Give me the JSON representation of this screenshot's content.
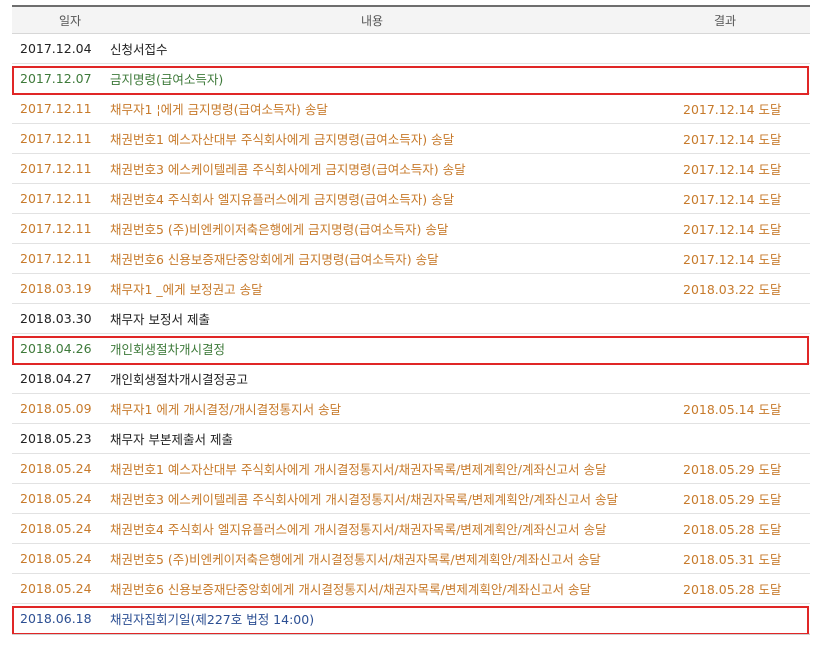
{
  "header": {
    "date": "일자",
    "content": "내용",
    "result": "결과"
  },
  "rows": [
    {
      "date": "2017.12.04",
      "content": "신청서접수",
      "result": "",
      "color": "black"
    },
    {
      "date": "2017.12.07",
      "content": "금지명령(급여소득자)",
      "result": "",
      "color": "green",
      "highlighted": true
    },
    {
      "date": "2017.12.11",
      "content": "채무자1        ¦에게 금지명령(급여소득자) 송달",
      "result": "2017.12.14 도달",
      "color": "orange"
    },
    {
      "date": "2017.12.11",
      "content": "채권번호1 예스자산대부 주식회사에게 금지명령(급여소득자) 송달",
      "result": "2017.12.14 도달",
      "color": "orange"
    },
    {
      "date": "2017.12.11",
      "content": "채권번호3 에스케이텔레콤 주식회사에게 금지명령(급여소득자) 송달",
      "result": "2017.12.14 도달",
      "color": "orange"
    },
    {
      "date": "2017.12.11",
      "content": "채권번호4 주식회사 엘지유플러스에게 금지명령(급여소득자) 송달",
      "result": "2017.12.14 도달",
      "color": "orange"
    },
    {
      "date": "2017.12.11",
      "content": "채권번호5 (주)비엔케이저축은행에게 금지명령(급여소득자) 송달",
      "result": "2017.12.14 도달",
      "color": "orange"
    },
    {
      "date": "2017.12.11",
      "content": "채권번호6 신용보증재단중앙회에게 금지명령(급여소득자) 송달",
      "result": "2017.12.14 도달",
      "color": "orange"
    },
    {
      "date": "2018.03.19",
      "content": "채무자1    _에게 보정권고 송달",
      "result": "2018.03.22 도달",
      "color": "orange"
    },
    {
      "date": "2018.03.30",
      "content": "채무자       보정서 제출",
      "result": "",
      "color": "black"
    },
    {
      "date": "2018.04.26",
      "content": "개인회생절차개시결정",
      "result": "",
      "color": "green",
      "highlighted": true
    },
    {
      "date": "2018.04.27",
      "content": "개인회생절차개시결정공고",
      "result": "",
      "color": "black"
    },
    {
      "date": "2018.05.09",
      "content": "채무자1          에게 개시결정/개시결정통지서 송달",
      "result": "2018.05.14 도달",
      "color": "orange"
    },
    {
      "date": "2018.05.23",
      "content": "채무자         부본제출서 제출",
      "result": "",
      "color": "black"
    },
    {
      "date": "2018.05.24",
      "content": "채권번호1 예스자산대부 주식회사에게 개시결정통지서/채권자목록/변제계획안/계좌신고서 송달",
      "result": "2018.05.29 도달",
      "color": "orange"
    },
    {
      "date": "2018.05.24",
      "content": "채권번호3 에스케이텔레콤 주식회사에게 개시결정통지서/채권자목록/변제계획안/계좌신고서 송달",
      "result": "2018.05.29 도달",
      "color": "orange"
    },
    {
      "date": "2018.05.24",
      "content": "채권번호4 주식회사 엘지유플러스에게 개시결정통지서/채권자목록/변제계획안/계좌신고서 송달",
      "result": "2018.05.28 도달",
      "color": "orange"
    },
    {
      "date": "2018.05.24",
      "content": "채권번호5 (주)비엔케이저축은행에게 개시결정통지서/채권자목록/변제계획안/계좌신고서 송달",
      "result": "2018.05.31 도달",
      "color": "orange"
    },
    {
      "date": "2018.05.24",
      "content": "채권번호6 신용보증재단중앙회에게 개시결정통지서/채권자목록/변제계획안/계좌신고서 송달",
      "result": "2018.05.28 도달",
      "color": "orange"
    },
    {
      "date": "2018.06.18",
      "content": "채권자집회기일(제227호 법정 14:00)",
      "result": "",
      "color": "blue",
      "highlighted": true
    }
  ],
  "colors": {
    "highlight_border": "#e02626",
    "orange": "#c77a2b",
    "green": "#3e7a3a",
    "blue": "#2c4f93"
  }
}
